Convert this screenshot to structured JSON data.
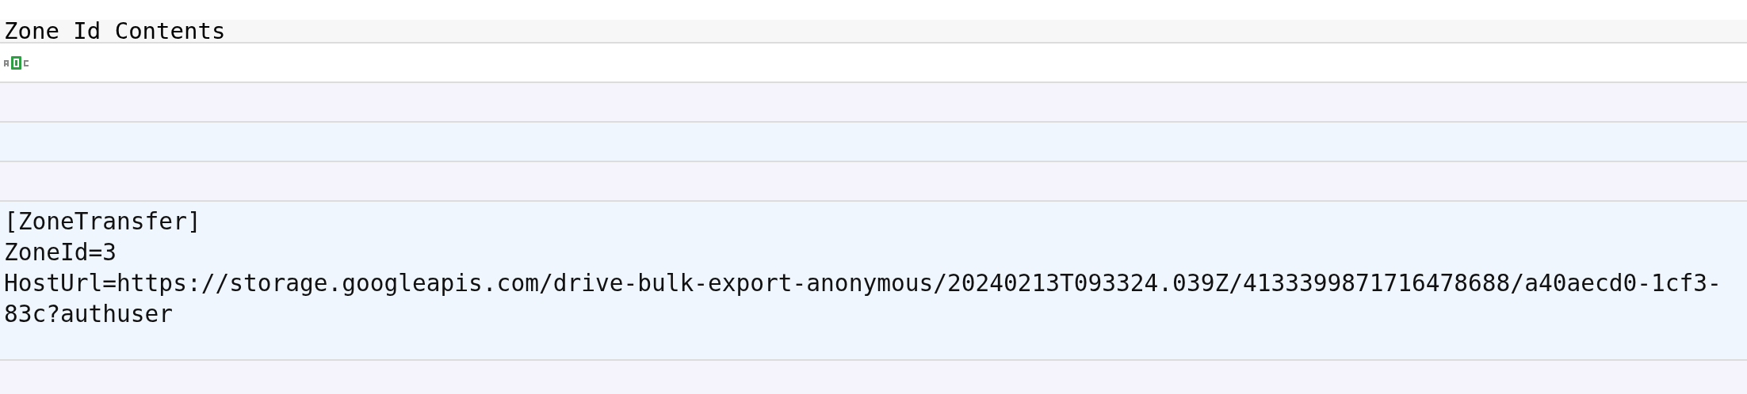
{
  "header": {
    "title": "Zone Id Contents"
  },
  "rows": [
    {
      "kind": "icon"
    },
    {
      "kind": "empty"
    },
    {
      "kind": "empty"
    },
    {
      "kind": "empty"
    },
    {
      "kind": "text",
      "lines": [
        "[ZoneTransfer]",
        "ZoneId=3",
        "HostUrl=https://storage.googleapis.com/drive-bulk-export-anonymous/20240213T093324.039Z/4133399871716478688/a40aecd0-1cf3-",
        "83c?authuser"
      ]
    },
    {
      "kind": "empty"
    }
  ]
}
